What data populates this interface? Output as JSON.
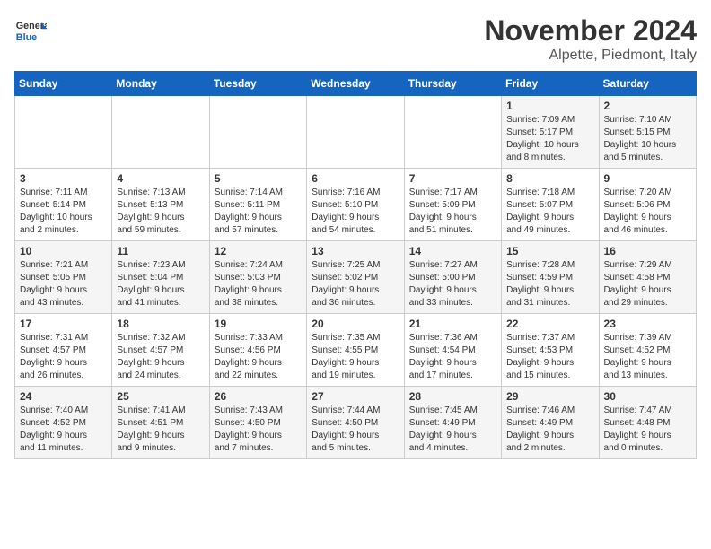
{
  "header": {
    "logo_line1": "General",
    "logo_line2": "Blue",
    "month_title": "November 2024",
    "location": "Alpette, Piedmont, Italy"
  },
  "weekdays": [
    "Sunday",
    "Monday",
    "Tuesday",
    "Wednesday",
    "Thursday",
    "Friday",
    "Saturday"
  ],
  "weeks": [
    [
      {
        "day": "",
        "info": ""
      },
      {
        "day": "",
        "info": ""
      },
      {
        "day": "",
        "info": ""
      },
      {
        "day": "",
        "info": ""
      },
      {
        "day": "",
        "info": ""
      },
      {
        "day": "1",
        "info": "Sunrise: 7:09 AM\nSunset: 5:17 PM\nDaylight: 10 hours\nand 8 minutes."
      },
      {
        "day": "2",
        "info": "Sunrise: 7:10 AM\nSunset: 5:15 PM\nDaylight: 10 hours\nand 5 minutes."
      }
    ],
    [
      {
        "day": "3",
        "info": "Sunrise: 7:11 AM\nSunset: 5:14 PM\nDaylight: 10 hours\nand 2 minutes."
      },
      {
        "day": "4",
        "info": "Sunrise: 7:13 AM\nSunset: 5:13 PM\nDaylight: 9 hours\nand 59 minutes."
      },
      {
        "day": "5",
        "info": "Sunrise: 7:14 AM\nSunset: 5:11 PM\nDaylight: 9 hours\nand 57 minutes."
      },
      {
        "day": "6",
        "info": "Sunrise: 7:16 AM\nSunset: 5:10 PM\nDaylight: 9 hours\nand 54 minutes."
      },
      {
        "day": "7",
        "info": "Sunrise: 7:17 AM\nSunset: 5:09 PM\nDaylight: 9 hours\nand 51 minutes."
      },
      {
        "day": "8",
        "info": "Sunrise: 7:18 AM\nSunset: 5:07 PM\nDaylight: 9 hours\nand 49 minutes."
      },
      {
        "day": "9",
        "info": "Sunrise: 7:20 AM\nSunset: 5:06 PM\nDaylight: 9 hours\nand 46 minutes."
      }
    ],
    [
      {
        "day": "10",
        "info": "Sunrise: 7:21 AM\nSunset: 5:05 PM\nDaylight: 9 hours\nand 43 minutes."
      },
      {
        "day": "11",
        "info": "Sunrise: 7:23 AM\nSunset: 5:04 PM\nDaylight: 9 hours\nand 41 minutes."
      },
      {
        "day": "12",
        "info": "Sunrise: 7:24 AM\nSunset: 5:03 PM\nDaylight: 9 hours\nand 38 minutes."
      },
      {
        "day": "13",
        "info": "Sunrise: 7:25 AM\nSunset: 5:02 PM\nDaylight: 9 hours\nand 36 minutes."
      },
      {
        "day": "14",
        "info": "Sunrise: 7:27 AM\nSunset: 5:00 PM\nDaylight: 9 hours\nand 33 minutes."
      },
      {
        "day": "15",
        "info": "Sunrise: 7:28 AM\nSunset: 4:59 PM\nDaylight: 9 hours\nand 31 minutes."
      },
      {
        "day": "16",
        "info": "Sunrise: 7:29 AM\nSunset: 4:58 PM\nDaylight: 9 hours\nand 29 minutes."
      }
    ],
    [
      {
        "day": "17",
        "info": "Sunrise: 7:31 AM\nSunset: 4:57 PM\nDaylight: 9 hours\nand 26 minutes."
      },
      {
        "day": "18",
        "info": "Sunrise: 7:32 AM\nSunset: 4:57 PM\nDaylight: 9 hours\nand 24 minutes."
      },
      {
        "day": "19",
        "info": "Sunrise: 7:33 AM\nSunset: 4:56 PM\nDaylight: 9 hours\nand 22 minutes."
      },
      {
        "day": "20",
        "info": "Sunrise: 7:35 AM\nSunset: 4:55 PM\nDaylight: 9 hours\nand 19 minutes."
      },
      {
        "day": "21",
        "info": "Sunrise: 7:36 AM\nSunset: 4:54 PM\nDaylight: 9 hours\nand 17 minutes."
      },
      {
        "day": "22",
        "info": "Sunrise: 7:37 AM\nSunset: 4:53 PM\nDaylight: 9 hours\nand 15 minutes."
      },
      {
        "day": "23",
        "info": "Sunrise: 7:39 AM\nSunset: 4:52 PM\nDaylight: 9 hours\nand 13 minutes."
      }
    ],
    [
      {
        "day": "24",
        "info": "Sunrise: 7:40 AM\nSunset: 4:52 PM\nDaylight: 9 hours\nand 11 minutes."
      },
      {
        "day": "25",
        "info": "Sunrise: 7:41 AM\nSunset: 4:51 PM\nDaylight: 9 hours\nand 9 minutes."
      },
      {
        "day": "26",
        "info": "Sunrise: 7:43 AM\nSunset: 4:50 PM\nDaylight: 9 hours\nand 7 minutes."
      },
      {
        "day": "27",
        "info": "Sunrise: 7:44 AM\nSunset: 4:50 PM\nDaylight: 9 hours\nand 5 minutes."
      },
      {
        "day": "28",
        "info": "Sunrise: 7:45 AM\nSunset: 4:49 PM\nDaylight: 9 hours\nand 4 minutes."
      },
      {
        "day": "29",
        "info": "Sunrise: 7:46 AM\nSunset: 4:49 PM\nDaylight: 9 hours\nand 2 minutes."
      },
      {
        "day": "30",
        "info": "Sunrise: 7:47 AM\nSunset: 4:48 PM\nDaylight: 9 hours\nand 0 minutes."
      }
    ]
  ]
}
